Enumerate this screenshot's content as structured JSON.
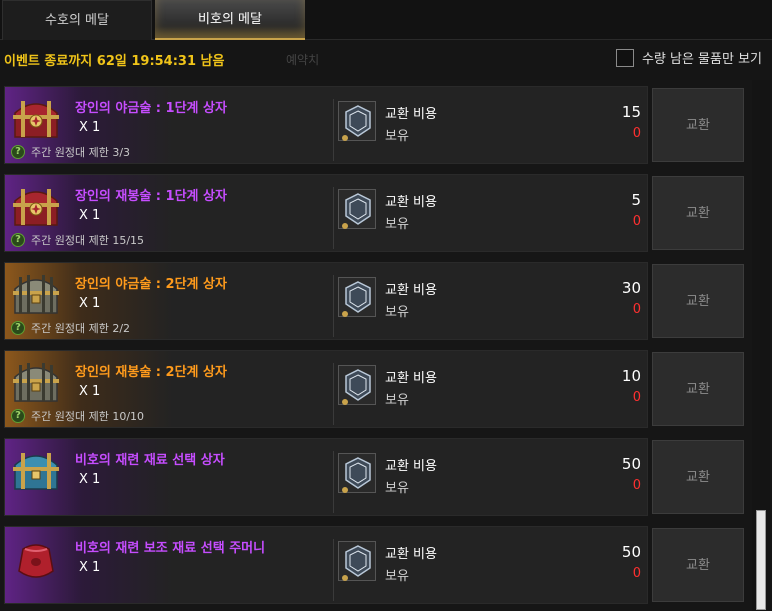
{
  "tabs": [
    {
      "label": "수호의 메달",
      "active": false
    },
    {
      "label": "비호의 메달",
      "active": true
    }
  ],
  "event": {
    "countdown_text": "이벤트 종료까지 62일 19:54:31 남음",
    "ghost_text": "예약치"
  },
  "filter": {
    "label": "수량 남은 물품만 보기",
    "checked": false
  },
  "colors": {
    "purple_grade": "#c64dff",
    "orange_grade": "#ff9b1c",
    "event_text": "#f0c419",
    "owned_zero": "#ff3030"
  },
  "items": [
    {
      "name": "장인의 야금술 : 1단계 상자",
      "grade": "purple",
      "icon": "red-treasure-chest-icon",
      "qty": "X 1",
      "limit": "주간 원정대 제한 3/3",
      "cost_label": "교환 비용",
      "cost": "15",
      "own_label": "보유",
      "own": "0",
      "button": "교환"
    },
    {
      "name": "장인의 재봉술 : 1단계 상자",
      "grade": "purple",
      "icon": "red-treasure-chest-icon",
      "qty": "X 1",
      "limit": "주간 원정대 제한 15/15",
      "cost_label": "교환 비용",
      "cost": "5",
      "own_label": "보유",
      "own": "0",
      "button": "교환"
    },
    {
      "name": "장인의 야금술 : 2단계 상자",
      "grade": "orange",
      "icon": "silver-treasure-chest-icon",
      "qty": "X 1",
      "limit": "주간 원정대 제한 2/2",
      "cost_label": "교환 비용",
      "cost": "30",
      "own_label": "보유",
      "own": "0",
      "button": "교환"
    },
    {
      "name": "장인의 재봉술 : 2단계 상자",
      "grade": "orange",
      "icon": "silver-treasure-chest-icon",
      "qty": "X 1",
      "limit": "주간 원정대 제한 10/10",
      "cost_label": "교환 비용",
      "cost": "10",
      "own_label": "보유",
      "own": "0",
      "button": "교환"
    },
    {
      "name": "비호의 재련 재료 선택 상자",
      "grade": "purple",
      "icon": "blue-treasure-chest-icon",
      "qty": "X 1",
      "limit": "",
      "cost_label": "교환 비용",
      "cost": "50",
      "own_label": "보유",
      "own": "0",
      "button": "교환"
    },
    {
      "name": "비호의 재련 보조 재료 선택 주머니",
      "grade": "purple",
      "icon": "red-pouch-icon",
      "qty": "X 1",
      "limit": "",
      "cost_label": "교환 비용",
      "cost": "50",
      "own_label": "보유",
      "own": "0",
      "button": "교환"
    }
  ]
}
